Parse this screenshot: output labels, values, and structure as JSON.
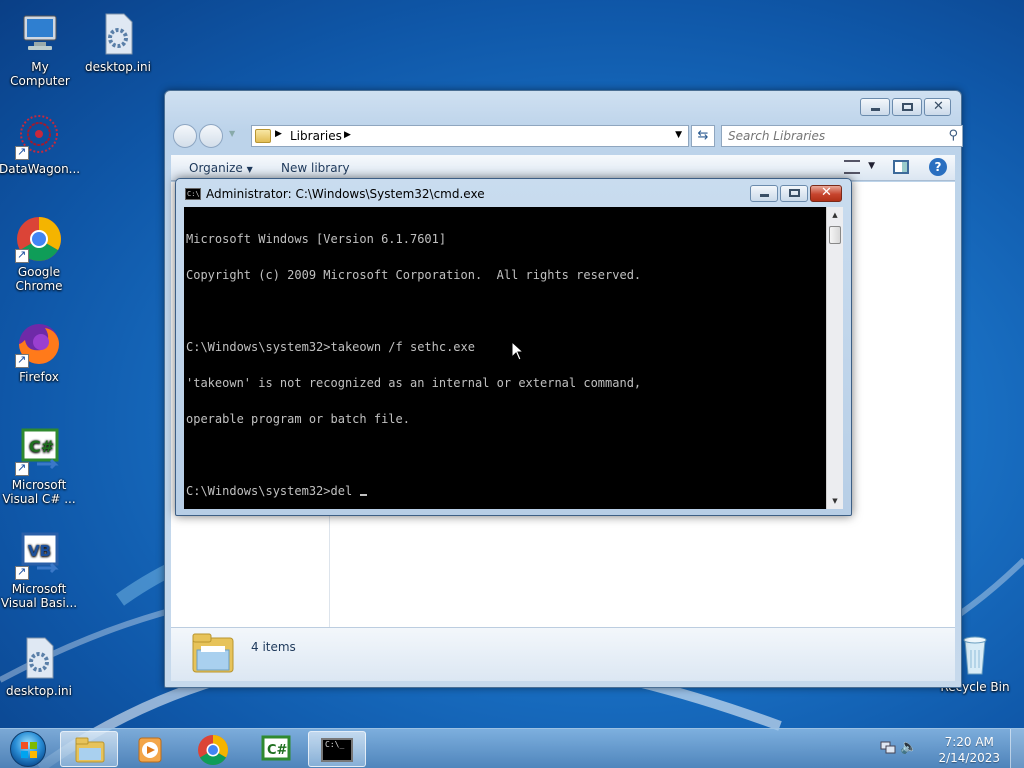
{
  "desktop": {
    "icons": [
      {
        "label": "My Computer"
      },
      {
        "label": "desktop.ini"
      },
      {
        "label": "DataWagon..."
      },
      {
        "label": "Google Chrome"
      },
      {
        "label": "Firefox"
      },
      {
        "label": "Microsoft Visual C# ..."
      },
      {
        "label": "Microsoft Visual Basi..."
      },
      {
        "label": "desktop.ini"
      },
      {
        "label": "Recycle Bin"
      }
    ]
  },
  "explorer": {
    "breadcrumb": "Libraries",
    "search_placeholder": "Search Libraries",
    "toolbar": {
      "organize": "Organize",
      "new_library": "New library"
    },
    "status_count": "4 items"
  },
  "cmd": {
    "title": "Administrator: C:\\Windows\\System32\\cmd.exe",
    "icon_text": "C:\\",
    "lines": [
      "Microsoft Windows [Version 6.1.7601]",
      "Copyright (c) 2009 Microsoft Corporation.  All rights reserved.",
      "",
      "C:\\Windows\\system32>takeown /f sethc.exe",
      "'takeown' is not recognized as an internal or external command,",
      "operable program or batch file.",
      "",
      "C:\\Windows\\system32>del "
    ]
  },
  "taskbar": {
    "cmd_label": "C:\\_",
    "clock_time": "7:20 AM",
    "clock_date": "2/14/2023"
  },
  "colors": {
    "console_bg": "#000000",
    "console_fg": "#c0c0c0",
    "close_red": "#c7452e"
  }
}
